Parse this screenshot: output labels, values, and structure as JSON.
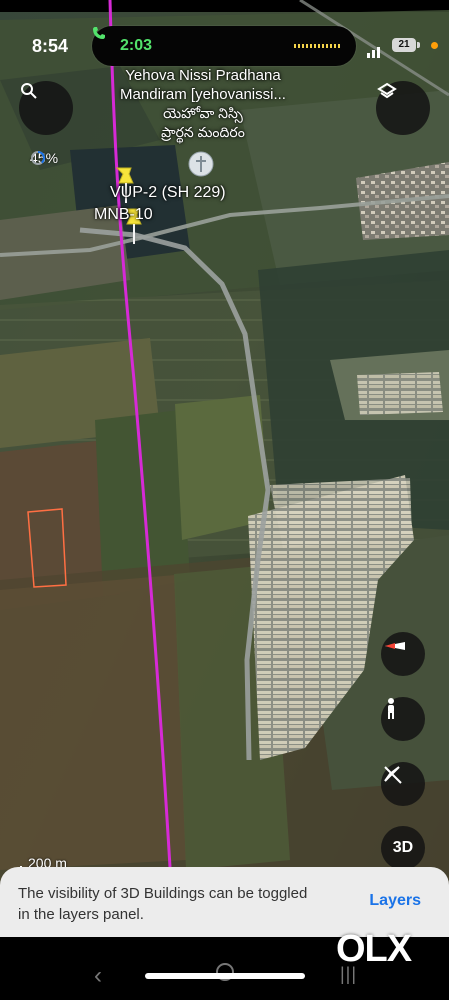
{
  "status_bar": {
    "time": "8:54",
    "call_timer": "2:03",
    "battery_level": "21"
  },
  "map": {
    "poi_name_line1": "Yehova Nissi Pradhana",
    "poi_name_line2": "Mandiram [yehovanissi...",
    "poi_name_line3": "యెహోవా నిస్సి",
    "poi_name_line4": "ప్రార్థన మందిరం",
    "pin_label_1": "VUP-2 (SH 229)",
    "pin_label_2": "MNB-10",
    "progress_text": "45%",
    "progress_value": 0.45,
    "scale_text": "200 m",
    "three_d_label": "3D",
    "icons": {
      "search": "search-icon",
      "layers": "layers-icon",
      "compass": "compass-icon",
      "street_view": "pegman-icon",
      "location_off": "location-off-icon",
      "cross": "cross-icon"
    },
    "route_color": "#d62ad6",
    "pin_color": "#f7e43b"
  },
  "toast": {
    "message": "The visibility of 3D Buildings can be toggled in the layers panel.",
    "action": "Layers"
  },
  "watermark": {
    "text": "OLX"
  }
}
